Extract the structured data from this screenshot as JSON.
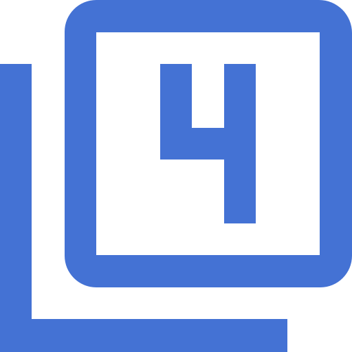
{
  "icon": {
    "name": "filter-4-icon",
    "glyph": "4",
    "color": "#4472d4",
    "background": "#ffffff"
  }
}
